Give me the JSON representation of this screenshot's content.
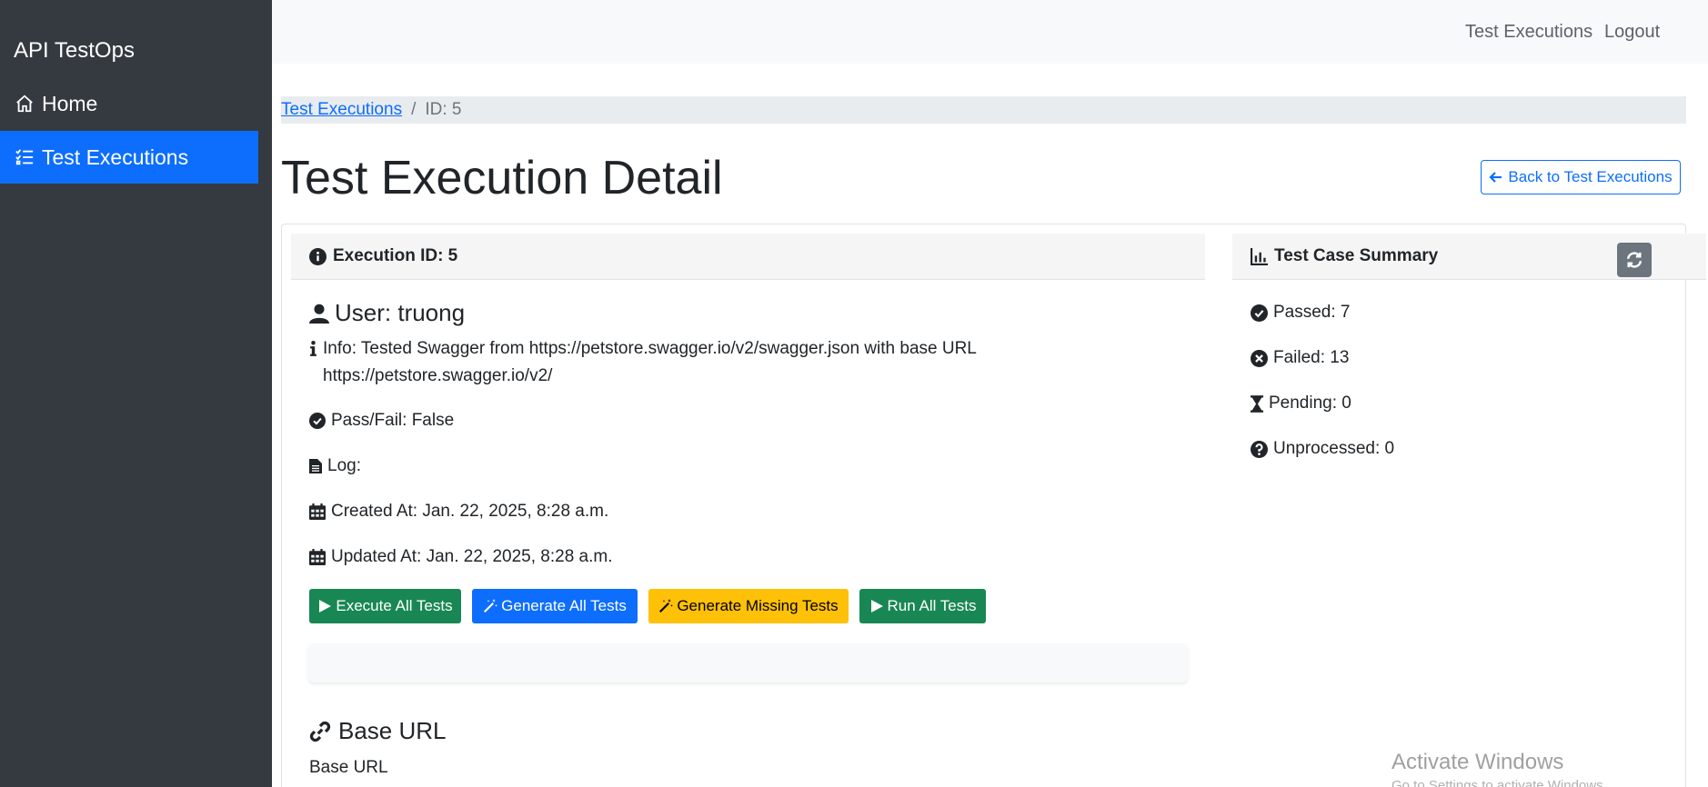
{
  "sidebar": {
    "brand": "API TestOps",
    "items": [
      {
        "label": "Home",
        "icon": "house-icon"
      },
      {
        "label": "Test Executions",
        "icon": "list-check-icon",
        "active": true
      }
    ]
  },
  "topnav": {
    "test_executions": "Test Executions",
    "logout": "Logout"
  },
  "breadcrumb": {
    "parent": "Test Executions",
    "separator": "/",
    "current": "ID: 5"
  },
  "page": {
    "title": "Test Execution Detail",
    "back_button": "Back to Test Executions"
  },
  "execution": {
    "header": "Execution ID: 5",
    "user": "User: truong",
    "info": "Info: Tested Swagger from https://petstore.swagger.io/v2/swagger.json with base URL https://petstore.swagger.io/v2/",
    "pass_fail": "Pass/Fail: False",
    "log": "Log:",
    "created_at": "Created At: Jan. 22, 2025, 8:28 a.m.",
    "updated_at": "Updated At: Jan. 22, 2025, 8:28 a.m.",
    "buttons": {
      "execute_all": "Execute All Tests",
      "generate_all": "Generate All Tests",
      "generate_missing": "Generate Missing Tests",
      "run_all": "Run All Tests"
    },
    "base_url_title": "Base URL",
    "base_url_text": "Base URL"
  },
  "summary": {
    "header": "Test Case Summary",
    "passed": "Passed: 7",
    "failed": "Failed: 13",
    "pending": "Pending: 0",
    "unprocessed": "Unprocessed: 0"
  },
  "watermark": {
    "title": "Activate Windows",
    "subtitle": "Go to Settings to activate Windows."
  },
  "colors": {
    "sidebar_bg": "#343a40",
    "primary": "#0d6efd",
    "success": "#198754",
    "warning": "#ffc107",
    "secondary": "#6c757d"
  }
}
